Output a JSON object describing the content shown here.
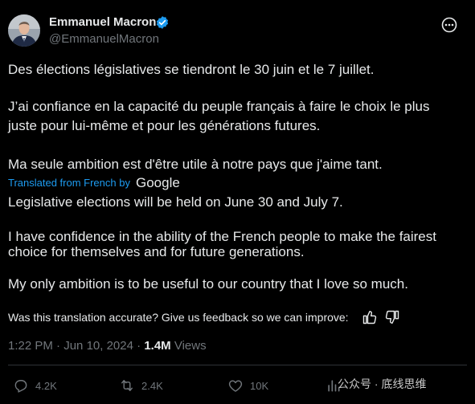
{
  "author": {
    "name": "Emmanuel Macron",
    "handle": "@EmmanuelMacron"
  },
  "icons": {
    "verified": "verified-badge-icon",
    "more": "more-options-icon",
    "reply": "reply-icon",
    "retweet": "retweet-icon",
    "like": "like-icon",
    "views": "views-icon",
    "thumb_up": "thumb-up-icon",
    "thumb_down": "thumb-down-icon"
  },
  "colors": {
    "background": "#000000",
    "text": "#e7e9ea",
    "secondary": "#71767b",
    "link": "#1d9bf0",
    "verified": "#1d9bf0"
  },
  "original": {
    "p1": "Des élections législatives se tiendront le 30 juin et le 7 juillet.",
    "p2_line1": "J’ai confiance en la capacité du peuple français à faire le choix le plus",
    "p2_line2": "juste pour lui-même et pour les générations futures.",
    "p3": "Ma seule ambition est d'être utile à notre pays que j'aime tant."
  },
  "translation": {
    "label": "Translated from French by",
    "provider": "Google",
    "p1": "Legislative elections will be held on June 30 and July 7.",
    "p2_line1": "I have confidence in the ability of the French people to make the fairest",
    "p2_line2": "choice for themselves and for future generations.",
    "p3": "My only ambition is to be useful to our country that I love so much.",
    "feedback": "Was this translation accurate? Give us feedback so we can improve:"
  },
  "meta": {
    "time": "1:22 PM",
    "separator": " · ",
    "date": "Jun 10, 2024",
    "views_count": "1.4M",
    "views_label": "Views"
  },
  "actions": {
    "replies": "4.2K",
    "retweets": "2.4K",
    "likes": "10K"
  },
  "watermark": "公众号 · 底线思维"
}
